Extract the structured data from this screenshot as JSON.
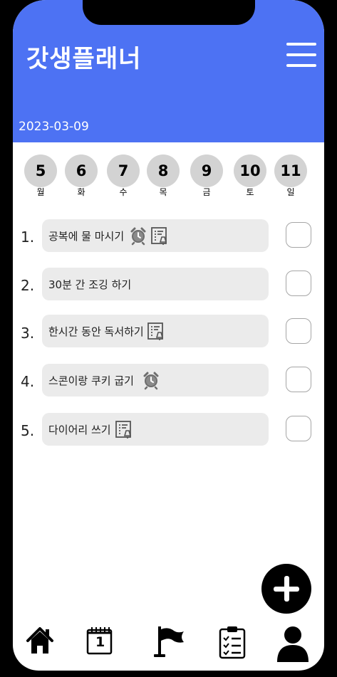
{
  "app": {
    "title": "갓생플래너"
  },
  "header": {
    "date": "2023-03-09"
  },
  "week": [
    {
      "day": "5",
      "weekday": "월"
    },
    {
      "day": "6",
      "weekday": "화"
    },
    {
      "day": "7",
      "weekday": "수"
    },
    {
      "day": "8",
      "weekday": "목"
    },
    {
      "day": "9",
      "weekday": "금"
    },
    {
      "day": "10",
      "weekday": "토"
    },
    {
      "day": "11",
      "weekday": "일"
    }
  ],
  "tasks": [
    {
      "num": "1.",
      "text": "공복에 물 마시기",
      "icons": [
        "alarm-icon",
        "memo-icon"
      ],
      "done": false
    },
    {
      "num": "2.",
      "text": "30분 간 조깅 하기",
      "icons": [],
      "done": false
    },
    {
      "num": "3.",
      "text": "한시간 동안 독서하기",
      "icons": [
        "memo-icon"
      ],
      "done": false
    },
    {
      "num": "4.",
      "text": "스콘이랑 쿠키 굽기",
      "icons": [
        "alarm-icon"
      ],
      "done": false
    },
    {
      "num": "5.",
      "text": "다이어리 쓰기",
      "icons": [
        "memo-icon"
      ],
      "done": false
    }
  ],
  "calendar_icon_day": "1",
  "bottom_nav": [
    "home-icon",
    "calendar-icon",
    "flag-icon",
    "checklist-icon",
    "profile-icon"
  ]
}
